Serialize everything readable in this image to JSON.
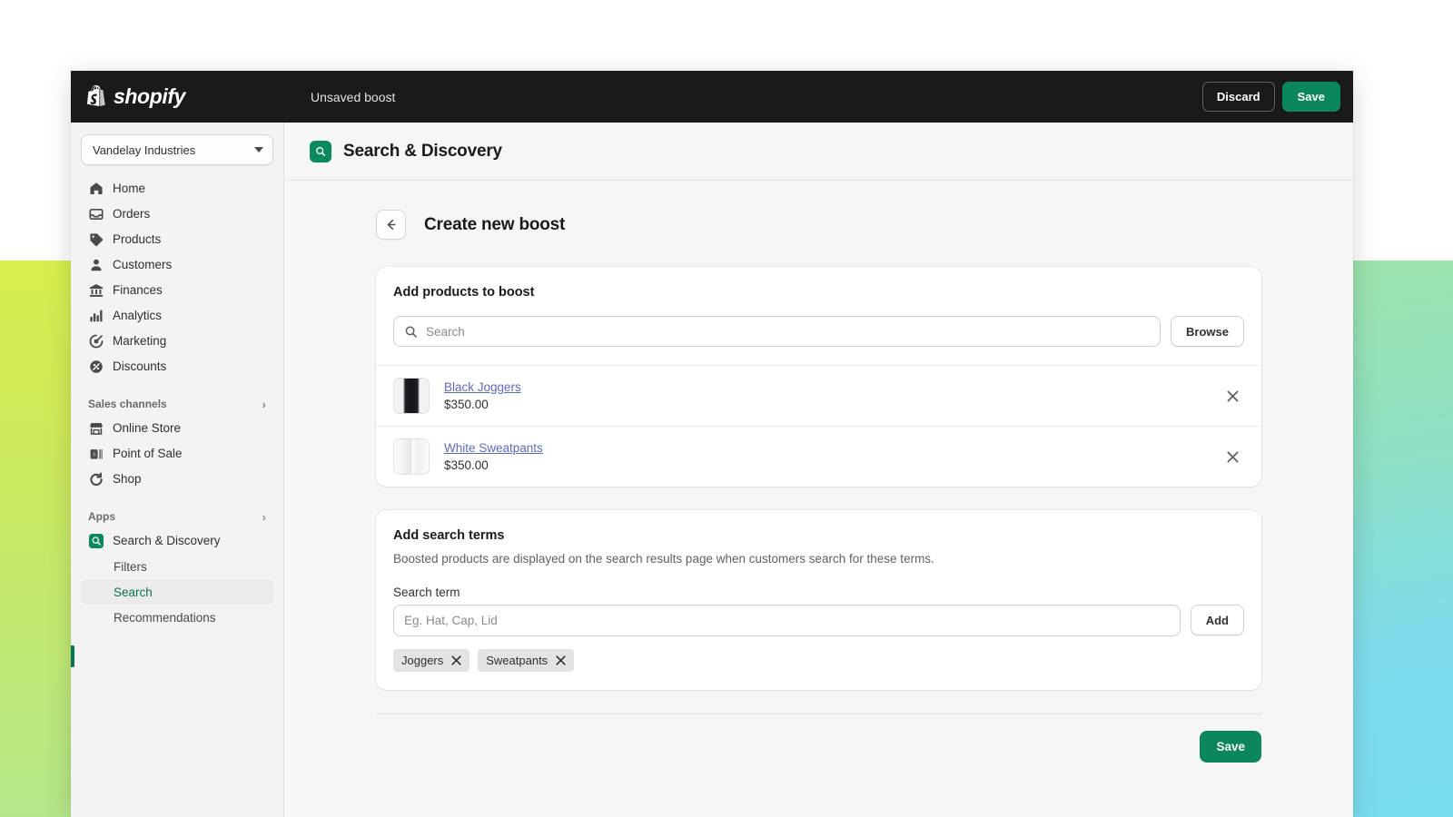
{
  "topbar": {
    "logo_text": "shopify",
    "title": "Unsaved boost",
    "discard_label": "Discard",
    "save_label": "Save"
  },
  "sidebar": {
    "store": "Vandelay Industries",
    "nav": [
      {
        "label": "Home",
        "icon": "home-icon"
      },
      {
        "label": "Orders",
        "icon": "orders-icon"
      },
      {
        "label": "Products",
        "icon": "products-tag-icon"
      },
      {
        "label": "Customers",
        "icon": "customers-person-icon"
      },
      {
        "label": "Finances",
        "icon": "finances-bank-icon"
      },
      {
        "label": "Analytics",
        "icon": "analytics-bars-icon"
      },
      {
        "label": "Marketing",
        "icon": "marketing-target-icon"
      },
      {
        "label": "Discounts",
        "icon": "discounts-percent-icon"
      }
    ],
    "sales_channels": {
      "label": "Sales channels",
      "items": [
        {
          "label": "Online Store",
          "icon": "storefront-icon"
        },
        {
          "label": "Point of Sale",
          "icon": "pos-icon"
        },
        {
          "label": "Shop",
          "icon": "shop-icon"
        }
      ]
    },
    "apps": {
      "label": "Apps",
      "app_name": "Search & Discovery",
      "sub_items": [
        {
          "label": "Filters",
          "active": false
        },
        {
          "label": "Search",
          "active": true
        },
        {
          "label": "Recommendations",
          "active": false
        }
      ]
    }
  },
  "main": {
    "header_title": "Search & Discovery",
    "page_title": "Create new boost",
    "products_card": {
      "title": "Add products to boost",
      "search_placeholder": "Search",
      "search_value": "",
      "browse_label": "Browse",
      "items": [
        {
          "name": "Black Joggers",
          "price": "$350.00",
          "thumb": "thumb-joggers"
        },
        {
          "name": "White Sweatpants",
          "price": "$350.00",
          "thumb": "thumb-sweatpants"
        }
      ]
    },
    "terms_card": {
      "title": "Add search terms",
      "description": "Boosted products are displayed on the search results page when customers search for these terms.",
      "field_label": "Search term",
      "input_placeholder": "Eg. Hat, Cap, Lid",
      "input_value": "",
      "add_label": "Add",
      "tags": [
        "Joggers",
        "Sweatpants"
      ]
    },
    "footer_save_label": "Save"
  },
  "colors": {
    "brand_green": "#0b875b",
    "active_green": "#0b7355",
    "link_blue": "#5c6ac4",
    "topbar_dark": "#1a1a1a"
  }
}
